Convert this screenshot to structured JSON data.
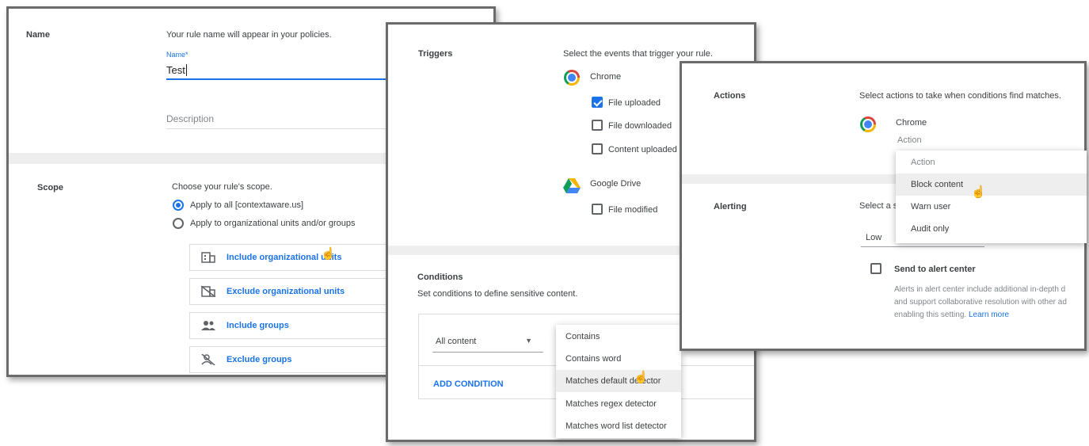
{
  "panel1": {
    "name_heading": "Name",
    "name_hint": "Your rule name will appear in your policies.",
    "name_label": "Name*",
    "name_value": "Test",
    "description_placeholder": "Description",
    "scope_heading": "Scope",
    "scope_hint": "Choose your rule's scope.",
    "radio_all": "Apply to all [contextaware.us]",
    "radio_org": "Apply to organizational units and/or groups",
    "scope_buttons": [
      {
        "label": "Include organizational units",
        "icon": "building-icon"
      },
      {
        "label": "Exclude organizational units",
        "icon": "building-off-icon"
      },
      {
        "label": "Include groups",
        "icon": "group-icon"
      },
      {
        "label": "Exclude groups",
        "icon": "group-off-icon"
      }
    ]
  },
  "panel2": {
    "triggers_heading": "Triggers",
    "triggers_hint": "Select the events that trigger your rule.",
    "chrome_label": "Chrome",
    "chrome_options": [
      {
        "label": "File uploaded",
        "checked": true
      },
      {
        "label": "File downloaded",
        "checked": false
      },
      {
        "label": "Content uploaded",
        "checked": false
      }
    ],
    "drive_label": "Google Drive",
    "drive_options": [
      {
        "label": "File modified",
        "checked": false
      }
    ],
    "conditions_heading": "Conditions",
    "conditions_hint": "Set conditions to define sensitive content.",
    "content_select": "All content",
    "add_condition": "ADD CONDITION",
    "condition_menu": [
      "Contains",
      "Contains word",
      "Matches default detector",
      "Matches regex detector",
      "Matches word list detector"
    ],
    "condition_menu_highlight": "Matches default detector"
  },
  "panel3": {
    "actions_heading": "Actions",
    "actions_hint": "Select actions to take when conditions find matches.",
    "chrome_label": "Chrome",
    "action_label": "Action",
    "action_menu": [
      "Action",
      "Block content",
      "Warn user",
      "Audit only"
    ],
    "action_menu_highlight": "Block content",
    "alerting_heading": "Alerting",
    "alerting_hint": "Select a s",
    "severity_value": "Low",
    "send_alert_label": "Send to alert center",
    "alert_desc_1": "Alerts in alert center include additional in-depth d",
    "alert_desc_2": "and support collaborative resolution with other ad",
    "alert_desc_3": "enabling this setting.",
    "learn_more": "Learn more"
  },
  "colors": {
    "accent": "#1a73e8",
    "panel_border": "#6b6b6b",
    "section_gap": "#eeeeee"
  }
}
